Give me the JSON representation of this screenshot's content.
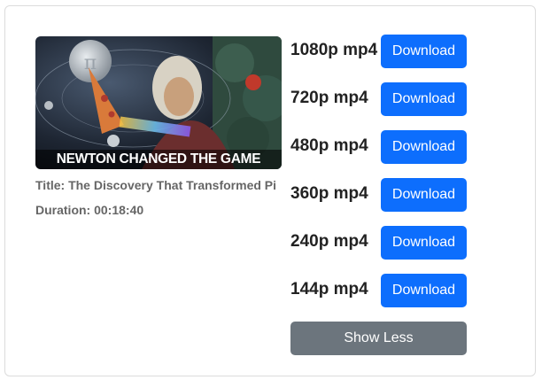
{
  "video": {
    "thumbnail_caption": "NEWTON CHANGED THE GAME",
    "title_line": "Title: The Discovery That Transformed Pi",
    "duration_line": "Duration: 00:18:40"
  },
  "downloads": [
    {
      "label": "1080p mp4",
      "button": "Download"
    },
    {
      "label": "720p mp4",
      "button": "Download"
    },
    {
      "label": "480p mp4",
      "button": "Download"
    },
    {
      "label": "360p mp4",
      "button": "Download"
    },
    {
      "label": "240p mp4",
      "button": "Download"
    },
    {
      "label": "144p mp4",
      "button": "Download"
    }
  ],
  "show_less_label": "Show Less",
  "colors": {
    "download_button": "#0d6efd",
    "show_less_button": "#6c757d"
  },
  "icons": [
    "pi-symbol"
  ]
}
